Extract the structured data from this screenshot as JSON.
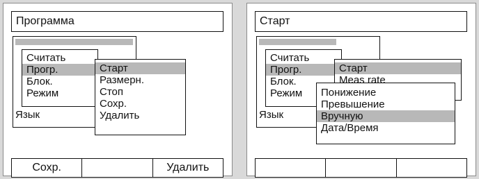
{
  "left": {
    "title": "Программа",
    "language_label": "Язык",
    "main_menu": [
      "Считать",
      "Прогр.",
      "Блок.",
      "Режим"
    ],
    "submenu": [
      "Старт",
      "Размерн.",
      "Стоп",
      "Сохр.",
      "Удалить"
    ],
    "softkeys": [
      "Сохр.",
      "",
      "Удалить"
    ]
  },
  "right": {
    "title": "Старт",
    "language_label": "Язык",
    "main_menu": [
      "Считать",
      "Прогр.",
      "Блок.",
      "Режим"
    ],
    "submenu_visible": [
      "Старт",
      "Meas rate"
    ],
    "options": [
      "Понижение",
      "Превышение",
      "Вручную",
      "Дата/Время"
    ],
    "softkeys": [
      "",
      "",
      ""
    ]
  },
  "colors": {
    "highlight": "#b8b8b8",
    "frame": "#111111",
    "background": "#d9d9d9"
  }
}
